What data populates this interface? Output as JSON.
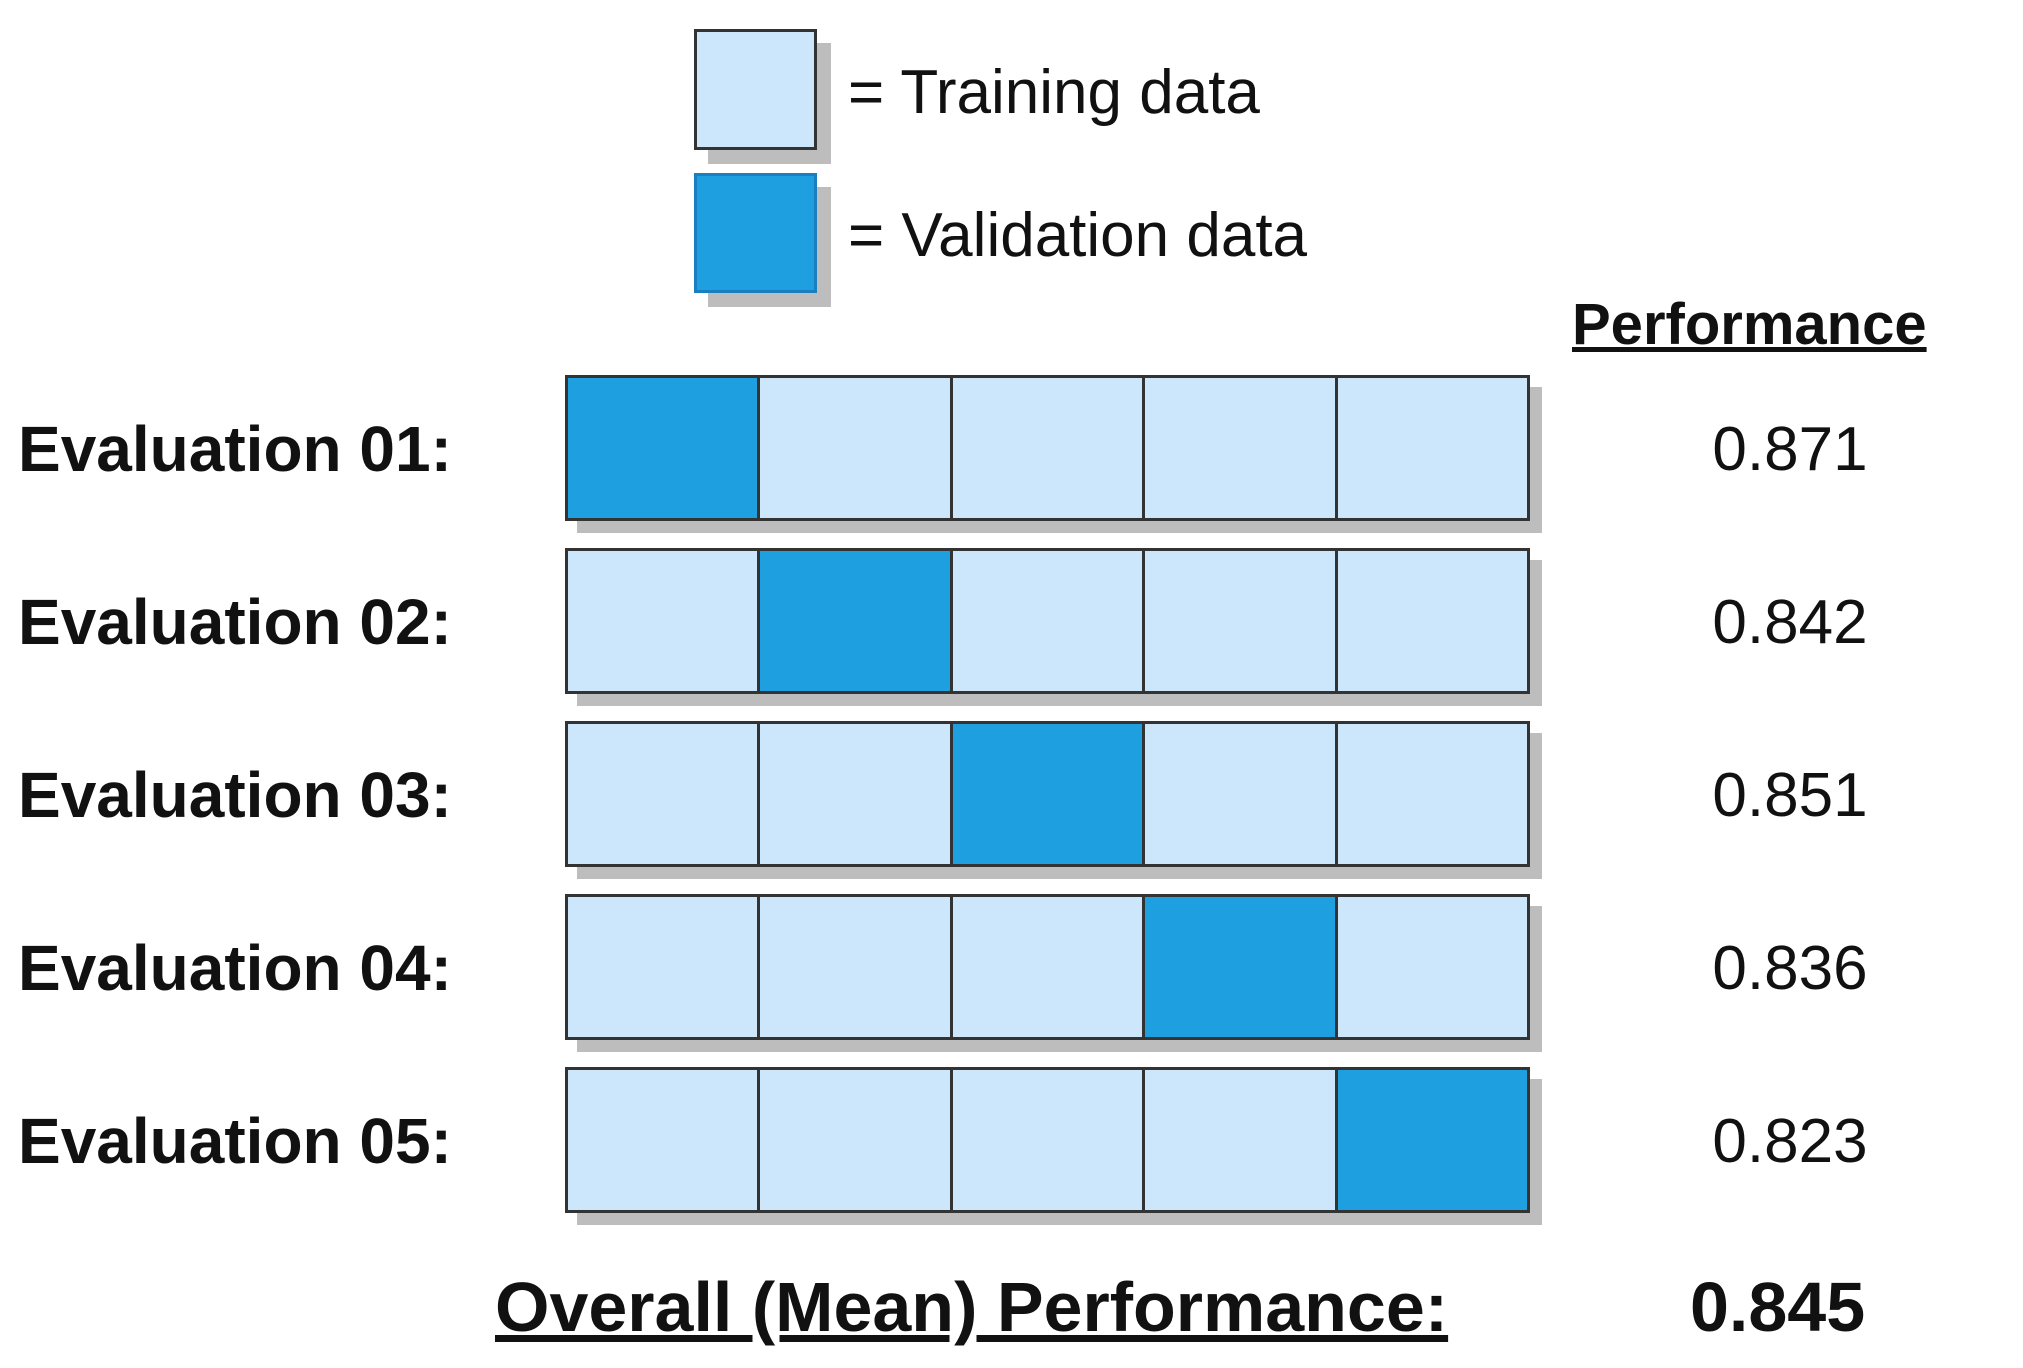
{
  "colors": {
    "training": "#cce6fb",
    "validation": "#1ea0e0",
    "border": "#333333",
    "shadow": "#bdbdbd"
  },
  "legend": {
    "training_label": "= Training data",
    "validation_label": "= Validation data"
  },
  "performance_header": "Performance",
  "folds": 5,
  "evaluations": [
    {
      "label": "Evaluation 01:",
      "validation_fold": 1,
      "performance": "0.871"
    },
    {
      "label": "Evaluation 02:",
      "validation_fold": 2,
      "performance": "0.842"
    },
    {
      "label": "Evaluation 03:",
      "validation_fold": 3,
      "performance": "0.851"
    },
    {
      "label": "Evaluation 04:",
      "validation_fold": 4,
      "performance": "0.836"
    },
    {
      "label": "Evaluation 05:",
      "validation_fold": 5,
      "performance": "0.823"
    }
  ],
  "overall": {
    "label": "Overall (Mean) Performance:",
    "value": "0.845"
  }
}
